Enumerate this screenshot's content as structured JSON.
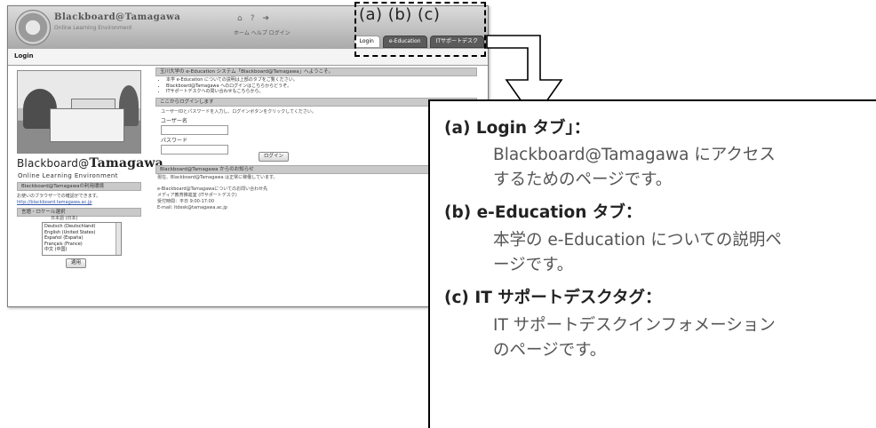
{
  "browser": {
    "brand_name": "Blackboard@Tamagawa",
    "brand_sub": "Online Learning Environment",
    "top_links": "ホーム ヘルプ ログイン",
    "tabs": [
      {
        "label": "Login",
        "active": true
      },
      {
        "label": "e-Education",
        "active": false
      },
      {
        "label": "ITサポートデスク",
        "active": false
      }
    ],
    "page_title": "Login"
  },
  "left_column": {
    "name_prefix": "Blackboard",
    "name_at": "@",
    "name_suffix": "Tamagawa",
    "subtitle": "Online Learning Environment",
    "bar1": "Blackboard@Tamagawaの利用環境",
    "note_line1": "お使いのブラウザーでの確認ができます。",
    "note_line2": "http://blackboard.tamagawa.ac.jp",
    "bar2": "言語・ロケール選択",
    "lang_heading": "日本語 (日本)",
    "languages": [
      "Deutsch (Deutschland)",
      "English (United States)",
      "Español (España)",
      "Français (France)",
      "中文 (中国)"
    ],
    "apply_button": "適用"
  },
  "right_column": {
    "bar1": "玉川大学の e-Education システム「Blackboard@Tamagawa」へようこそ。",
    "bullets": [
      "本学 e-Education についての説明は上部のタブをご覧ください。",
      "Blackboard@Tamagawa へのログインはこちらからどうぞ。",
      "ITサポートデスクへの問い合わせもこちらから。"
    ],
    "bar2": "ここからログインします",
    "login_intro": "ユーザーIDとパスワードを入力し、ログインボタンをクリックしてください。",
    "user_label": "ユーザー名",
    "pass_label": "パスワード",
    "login_button": "ログイン",
    "bar3": "Blackboard@Tamagawa からのお知らせ",
    "notice1": "現在、Blackboard@Tamagawa は正常に稼働しています。",
    "notice2": "e-Blackboard@Tamagawaについてのお問い合わせ先",
    "notice3": "メディア教育推進室 (ITサポートデスク)",
    "notice4": "受付時間：平日 9:00-17:00",
    "notice5": "E-mail: itdesk@tamagawa.ac.jp"
  },
  "callout_markers": "(a) (b) (c)",
  "callout": {
    "a_head": "(a) Login タブ」：",
    "a_body1": "Blackboard@Tamagawa にアクセス",
    "a_body2": "するためのページです。",
    "b_head": "(b) e-Education タブ：",
    "b_body1": "本学の e-Education についての説明ペ",
    "b_body2": "ージです。",
    "c_head": "(c) IT サポートデスクタグ：",
    "c_body1": "IT サポートデスクインフォメーション",
    "c_body2": "のページです。"
  }
}
